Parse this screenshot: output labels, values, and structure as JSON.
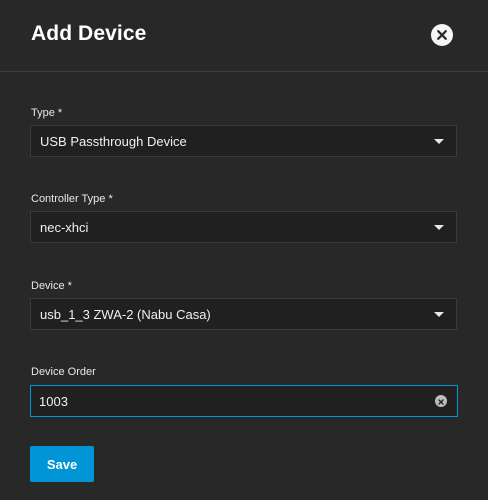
{
  "dialog": {
    "title": "Add Device"
  },
  "fields": {
    "type": {
      "label": "Type *",
      "value": "USB Passthrough Device"
    },
    "controller_type": {
      "label": "Controller Type *",
      "value": "nec-xhci"
    },
    "device": {
      "label": "Device *",
      "value": "usb_1_3 ZWA-2 (Nabu Casa)"
    },
    "device_order": {
      "label": "Device Order",
      "value": "1003"
    }
  },
  "actions": {
    "save_label": "Save"
  },
  "colors": {
    "background": "#282828",
    "field_background": "#202020",
    "accent": "#0095d5",
    "text": "#e6e6e6"
  },
  "icons": {
    "close": "close-icon",
    "dropdown": "chevron-down-icon",
    "clear": "clear-icon"
  }
}
